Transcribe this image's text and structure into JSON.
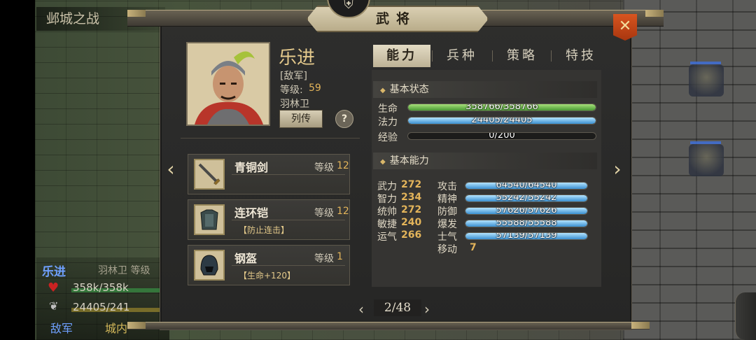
{
  "background": {
    "battle_title": "邺城之战",
    "status": {
      "name": "乐进",
      "unit": "羽林卫 等级",
      "hp": "358k/358k",
      "mp": "24405/241",
      "faction": "敌军",
      "location": "城内"
    }
  },
  "panel": {
    "title": "武将",
    "emblem_icon": "helmet-emblem-icon",
    "close_icon": "close-x-icon"
  },
  "general": {
    "name": "乐进",
    "faction": "[敌军]",
    "level_label": "等级:",
    "level": "59",
    "troop": "羽林卫",
    "bio_button": "列传",
    "help_button": "?"
  },
  "equipment": [
    {
      "name": "青铜剑",
      "level_label": "等级",
      "level": "12",
      "effect": "",
      "icon": "sword-icon"
    },
    {
      "name": "连环铠",
      "level_label": "等级",
      "level": "12",
      "effect": "【防止连击】",
      "icon": "chain-armor-icon"
    },
    {
      "name": "钢盔",
      "level_label": "等级",
      "level": "1",
      "effect": "【生命+120】",
      "icon": "steel-helmet-icon"
    }
  ],
  "nav": {
    "prev": "‹",
    "next": "›"
  },
  "tabs": [
    {
      "label": "能力",
      "active": true
    },
    {
      "label": "兵种",
      "active": false
    },
    {
      "label": "策略",
      "active": false
    },
    {
      "label": "特技",
      "active": false
    }
  ],
  "basic_status": {
    "header": "基本状态",
    "rows": [
      {
        "label": "生命",
        "text": "358766/358766",
        "fill": 1.0,
        "color": "green"
      },
      {
        "label": "法力",
        "text": "24405/24405",
        "fill": 1.0,
        "color": "blue"
      },
      {
        "label": "经验",
        "text": "0/200",
        "fill": 0.0,
        "color": "blue"
      }
    ]
  },
  "basic_ability": {
    "header": "基本能力",
    "attributes": [
      {
        "label": "武力",
        "value": "272"
      },
      {
        "label": "智力",
        "value": "234"
      },
      {
        "label": "统帅",
        "value": "272"
      },
      {
        "label": "敏捷",
        "value": "240"
      },
      {
        "label": "运气",
        "value": "266"
      }
    ],
    "combat": [
      {
        "label": "攻击",
        "text": "64540/64540",
        "fill": 1.0
      },
      {
        "label": "精神",
        "text": "55242/55242",
        "fill": 1.0
      },
      {
        "label": "防御",
        "text": "57626/57626",
        "fill": 1.0
      },
      {
        "label": "爆发",
        "text": "55588/55588",
        "fill": 1.0
      },
      {
        "label": "士气",
        "text": "57139/57139",
        "fill": 1.0
      }
    ],
    "move_label": "移动",
    "move_value": "7"
  },
  "pager": {
    "text": "2/48",
    "prev": "‹",
    "next": "›"
  },
  "colors": {
    "accent_gold": "#e3b45a",
    "name_gold": "#e4c98c",
    "close_orange": "#d8551f",
    "hp_green": "#4a9a35",
    "bar_blue": "#3a8fd0"
  }
}
